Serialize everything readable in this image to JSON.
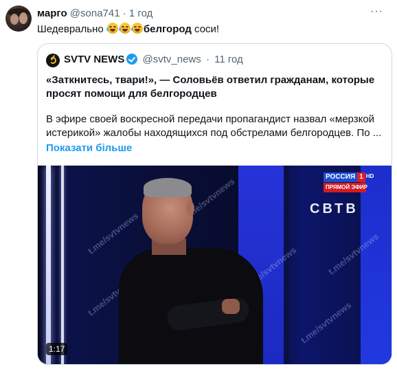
{
  "tweet": {
    "author_name": "марго",
    "author_handle": "@sona741",
    "separator": "·",
    "time": "1 год",
    "more": "···",
    "text_before": "Шедеврально",
    "emojis": [
      "😂",
      "😂",
      "😂"
    ],
    "text_bold": "белгород",
    "text_after": " соси!"
  },
  "quote": {
    "author_name": "SVTV NEWS",
    "author_handle": "@svtv_news",
    "separator": "·",
    "time": "11 год",
    "title": "«Заткнитесь, твари!», — Соловьёв ответил гражданам, которые просят помощи для белгородцев",
    "body": "В эфире своей воскресной передачи пропагандист назвал «мерзкой истерикой» жалобы находящихся под обстрелами белгородцев. По ...",
    "show_more": "Показати більше"
  },
  "video": {
    "channel_name": "РОССИЯ",
    "channel_number": "1",
    "channel_hd": "HD",
    "live_label": "ПРЯМОЙ ЭФИР",
    "brand_logo": "СВТВ",
    "watermark": "t.me/svtvnews",
    "duration": "1:17"
  },
  "colors": {
    "link": "#1d9bf0",
    "secondary_text": "#536471",
    "border": "#cfd9de",
    "verified": "#1d9bf0"
  }
}
